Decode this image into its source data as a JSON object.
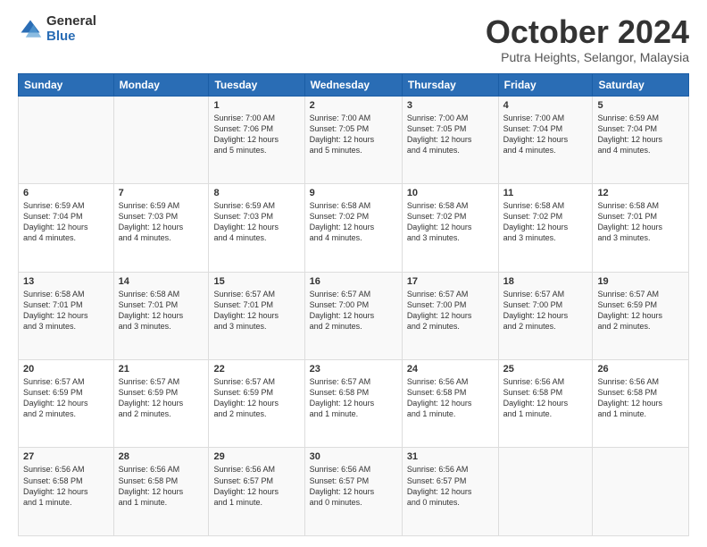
{
  "logo": {
    "general": "General",
    "blue": "Blue"
  },
  "header": {
    "month": "October 2024",
    "location": "Putra Heights, Selangor, Malaysia"
  },
  "days_of_week": [
    "Sunday",
    "Monday",
    "Tuesday",
    "Wednesday",
    "Thursday",
    "Friday",
    "Saturday"
  ],
  "weeks": [
    [
      {
        "day": "",
        "info": ""
      },
      {
        "day": "",
        "info": ""
      },
      {
        "day": "1",
        "info": "Sunrise: 7:00 AM\nSunset: 7:06 PM\nDaylight: 12 hours\nand 5 minutes."
      },
      {
        "day": "2",
        "info": "Sunrise: 7:00 AM\nSunset: 7:05 PM\nDaylight: 12 hours\nand 5 minutes."
      },
      {
        "day": "3",
        "info": "Sunrise: 7:00 AM\nSunset: 7:05 PM\nDaylight: 12 hours\nand 4 minutes."
      },
      {
        "day": "4",
        "info": "Sunrise: 7:00 AM\nSunset: 7:04 PM\nDaylight: 12 hours\nand 4 minutes."
      },
      {
        "day": "5",
        "info": "Sunrise: 6:59 AM\nSunset: 7:04 PM\nDaylight: 12 hours\nand 4 minutes."
      }
    ],
    [
      {
        "day": "6",
        "info": "Sunrise: 6:59 AM\nSunset: 7:04 PM\nDaylight: 12 hours\nand 4 minutes."
      },
      {
        "day": "7",
        "info": "Sunrise: 6:59 AM\nSunset: 7:03 PM\nDaylight: 12 hours\nand 4 minutes."
      },
      {
        "day": "8",
        "info": "Sunrise: 6:59 AM\nSunset: 7:03 PM\nDaylight: 12 hours\nand 4 minutes."
      },
      {
        "day": "9",
        "info": "Sunrise: 6:58 AM\nSunset: 7:02 PM\nDaylight: 12 hours\nand 4 minutes."
      },
      {
        "day": "10",
        "info": "Sunrise: 6:58 AM\nSunset: 7:02 PM\nDaylight: 12 hours\nand 3 minutes."
      },
      {
        "day": "11",
        "info": "Sunrise: 6:58 AM\nSunset: 7:02 PM\nDaylight: 12 hours\nand 3 minutes."
      },
      {
        "day": "12",
        "info": "Sunrise: 6:58 AM\nSunset: 7:01 PM\nDaylight: 12 hours\nand 3 minutes."
      }
    ],
    [
      {
        "day": "13",
        "info": "Sunrise: 6:58 AM\nSunset: 7:01 PM\nDaylight: 12 hours\nand 3 minutes."
      },
      {
        "day": "14",
        "info": "Sunrise: 6:58 AM\nSunset: 7:01 PM\nDaylight: 12 hours\nand 3 minutes."
      },
      {
        "day": "15",
        "info": "Sunrise: 6:57 AM\nSunset: 7:01 PM\nDaylight: 12 hours\nand 3 minutes."
      },
      {
        "day": "16",
        "info": "Sunrise: 6:57 AM\nSunset: 7:00 PM\nDaylight: 12 hours\nand 2 minutes."
      },
      {
        "day": "17",
        "info": "Sunrise: 6:57 AM\nSunset: 7:00 PM\nDaylight: 12 hours\nand 2 minutes."
      },
      {
        "day": "18",
        "info": "Sunrise: 6:57 AM\nSunset: 7:00 PM\nDaylight: 12 hours\nand 2 minutes."
      },
      {
        "day": "19",
        "info": "Sunrise: 6:57 AM\nSunset: 6:59 PM\nDaylight: 12 hours\nand 2 minutes."
      }
    ],
    [
      {
        "day": "20",
        "info": "Sunrise: 6:57 AM\nSunset: 6:59 PM\nDaylight: 12 hours\nand 2 minutes."
      },
      {
        "day": "21",
        "info": "Sunrise: 6:57 AM\nSunset: 6:59 PM\nDaylight: 12 hours\nand 2 minutes."
      },
      {
        "day": "22",
        "info": "Sunrise: 6:57 AM\nSunset: 6:59 PM\nDaylight: 12 hours\nand 2 minutes."
      },
      {
        "day": "23",
        "info": "Sunrise: 6:57 AM\nSunset: 6:58 PM\nDaylight: 12 hours\nand 1 minute."
      },
      {
        "day": "24",
        "info": "Sunrise: 6:56 AM\nSunset: 6:58 PM\nDaylight: 12 hours\nand 1 minute."
      },
      {
        "day": "25",
        "info": "Sunrise: 6:56 AM\nSunset: 6:58 PM\nDaylight: 12 hours\nand 1 minute."
      },
      {
        "day": "26",
        "info": "Sunrise: 6:56 AM\nSunset: 6:58 PM\nDaylight: 12 hours\nand 1 minute."
      }
    ],
    [
      {
        "day": "27",
        "info": "Sunrise: 6:56 AM\nSunset: 6:58 PM\nDaylight: 12 hours\nand 1 minute."
      },
      {
        "day": "28",
        "info": "Sunrise: 6:56 AM\nSunset: 6:58 PM\nDaylight: 12 hours\nand 1 minute."
      },
      {
        "day": "29",
        "info": "Sunrise: 6:56 AM\nSunset: 6:57 PM\nDaylight: 12 hours\nand 1 minute."
      },
      {
        "day": "30",
        "info": "Sunrise: 6:56 AM\nSunset: 6:57 PM\nDaylight: 12 hours\nand 0 minutes."
      },
      {
        "day": "31",
        "info": "Sunrise: 6:56 AM\nSunset: 6:57 PM\nDaylight: 12 hours\nand 0 minutes."
      },
      {
        "day": "",
        "info": ""
      },
      {
        "day": "",
        "info": ""
      }
    ]
  ]
}
